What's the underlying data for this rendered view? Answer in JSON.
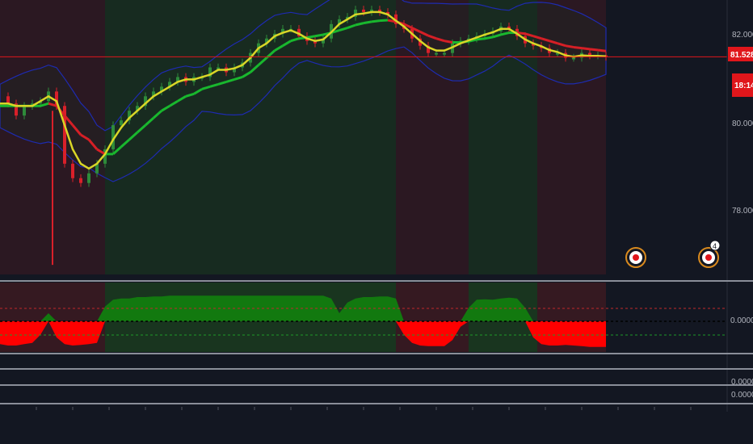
{
  "colors": {
    "background": "#131722",
    "bull_zone": "#1c3d1f",
    "bear_zone": "#3f1a22",
    "band_outline": "#1e2bb0",
    "fast_ma": "#d9d627",
    "slow_ma_bull": "#19b82e",
    "slow_ma_bear": "#d61f26",
    "price_line": "#e0161b",
    "osc_positive": "#12790f",
    "osc_negative": "#ff0000",
    "separator": "#8a8e99",
    "event_ring": "#d98a1e"
  },
  "price_axis": {
    "ticks": [
      "82.000",
      "80.000",
      "78.000"
    ],
    "current_price": "81.528",
    "countdown": "18:14"
  },
  "oscillator_axis": {
    "ticks": [
      "0.0000"
    ]
  },
  "extra_panes": {
    "labels": [
      "0.0000",
      "0.0000"
    ]
  },
  "events": {
    "badge_count": "4"
  },
  "chart_data": {
    "type": "line",
    "title": "",
    "xlabel": "",
    "ylabel": "",
    "ylim": [
      77,
      82.7
    ],
    "x": [
      0,
      10,
      20,
      30,
      40,
      50,
      60,
      70,
      80,
      90,
      100,
      110,
      120,
      130,
      140,
      150,
      160,
      170,
      180,
      190,
      200,
      210,
      220,
      230,
      240,
      250,
      260,
      270,
      280,
      290,
      300,
      310,
      320,
      330,
      340,
      350,
      360,
      370,
      380,
      390,
      400,
      410,
      420,
      430,
      440,
      450,
      460,
      470,
      480,
      490,
      500,
      510,
      520,
      530,
      540,
      550,
      560,
      570,
      580,
      590,
      600,
      610,
      620,
      630,
      640,
      650,
      660,
      670,
      680,
      690,
      700,
      710,
      720,
      730,
      740,
      750
    ],
    "series": [
      {
        "role": "price",
        "values": [
          80.7,
          80.55,
          80.3,
          80.5,
          80.55,
          80.6,
          80.8,
          80.5,
          79.3,
          79.0,
          78.9,
          79.1,
          79.3,
          79.6,
          80.1,
          80.2,
          80.4,
          80.5,
          80.7,
          80.8,
          80.9,
          81.0,
          81.1,
          81.0,
          81.1,
          81.1,
          81.3,
          81.3,
          81.2,
          81.3,
          81.4,
          81.6,
          81.8,
          81.9,
          82.0,
          82.1,
          82.1,
          81.95,
          81.85,
          81.8,
          81.9,
          82.2,
          82.3,
          82.35,
          82.5,
          82.45,
          82.5,
          82.45,
          82.4,
          82.2,
          82.1,
          81.9,
          81.75,
          81.6,
          81.6,
          81.6,
          81.8,
          81.85,
          81.9,
          81.95,
          82.0,
          82.05,
          82.15,
          82.1,
          81.95,
          81.8,
          81.75,
          81.7,
          81.6,
          81.6,
          81.5,
          81.5,
          81.6,
          81.55,
          81.55,
          81.52
        ]
      },
      {
        "role": "fast_ma",
        "values": [
          80.55,
          80.55,
          80.5,
          80.5,
          80.5,
          80.6,
          80.7,
          80.6,
          80.1,
          79.6,
          79.3,
          79.2,
          79.3,
          79.5,
          79.8,
          80.05,
          80.25,
          80.4,
          80.55,
          80.7,
          80.8,
          80.9,
          81.0,
          81.05,
          81.05,
          81.1,
          81.15,
          81.25,
          81.25,
          81.28,
          81.35,
          81.5,
          81.7,
          81.8,
          81.95,
          82.02,
          82.07,
          82.0,
          81.9,
          81.85,
          81.88,
          82.03,
          82.2,
          82.3,
          82.4,
          82.42,
          82.45,
          82.45,
          82.4,
          82.27,
          82.15,
          82.0,
          81.85,
          81.72,
          81.65,
          81.65,
          81.72,
          81.8,
          81.86,
          81.92,
          81.98,
          82.03,
          82.1,
          82.1,
          82.0,
          81.88,
          81.8,
          81.74,
          81.66,
          81.62,
          81.55,
          81.52,
          81.55,
          81.54,
          81.54,
          81.53
        ]
      },
      {
        "role": "slow_ma",
        "values": [
          80.5,
          80.5,
          80.5,
          80.5,
          80.5,
          80.5,
          80.55,
          80.5,
          80.3,
          80.1,
          79.9,
          79.8,
          79.6,
          79.5,
          79.5,
          79.65,
          79.8,
          79.95,
          80.1,
          80.25,
          80.4,
          80.5,
          80.6,
          80.7,
          80.75,
          80.85,
          80.9,
          80.95,
          81.0,
          81.05,
          81.1,
          81.2,
          81.35,
          81.5,
          81.65,
          81.75,
          81.85,
          81.9,
          81.92,
          81.95,
          81.98,
          82.02,
          82.07,
          82.12,
          82.18,
          82.22,
          82.25,
          82.27,
          82.28,
          82.25,
          82.2,
          82.12,
          82.04,
          81.96,
          81.9,
          81.85,
          81.82,
          81.82,
          81.84,
          81.88,
          81.9,
          81.93,
          81.98,
          82.02,
          82.02,
          82.0,
          81.95,
          81.9,
          81.85,
          81.8,
          81.75,
          81.72,
          81.7,
          81.68,
          81.66,
          81.64
        ]
      }
    ],
    "oscillator": {
      "values": [
        -0.85,
        -0.9,
        -0.9,
        -0.85,
        -0.8,
        -0.5,
        0.3,
        -0.6,
        -0.85,
        -0.9,
        -0.88,
        -0.85,
        -0.8,
        0.55,
        0.8,
        0.85,
        0.85,
        0.9,
        0.9,
        0.92,
        0.92,
        0.95,
        0.95,
        0.95,
        0.95,
        0.95,
        0.95,
        0.95,
        0.95,
        0.95,
        0.95,
        0.95,
        0.95,
        0.95,
        0.95,
        0.95,
        0.95,
        0.95,
        0.95,
        0.95,
        0.95,
        0.85,
        0.3,
        0.7,
        0.85,
        0.9,
        0.9,
        0.92,
        0.92,
        0.85,
        -0.5,
        -0.8,
        -0.9,
        -0.92,
        -0.92,
        -0.92,
        -0.7,
        -0.2,
        0.5,
        0.8,
        0.82,
        0.8,
        0.85,
        0.88,
        0.85,
        0.5,
        -0.6,
        -0.85,
        -0.9,
        -0.9,
        -0.88,
        -0.9,
        -0.92,
        -0.95,
        -0.95,
        -0.95
      ],
      "ylim": [
        -1.2,
        1.2
      ]
    },
    "zones": [
      {
        "from": 0,
        "to": 60,
        "trend": "bear"
      },
      {
        "from": 60,
        "to": 130,
        "trend": "bear"
      },
      {
        "from": 130,
        "to": 490,
        "trend": "bull"
      },
      {
        "from": 490,
        "to": 580,
        "trend": "bear"
      },
      {
        "from": 580,
        "to": 665,
        "trend": "bull"
      },
      {
        "from": 665,
        "to": 750,
        "trend": "bear"
      }
    ]
  }
}
